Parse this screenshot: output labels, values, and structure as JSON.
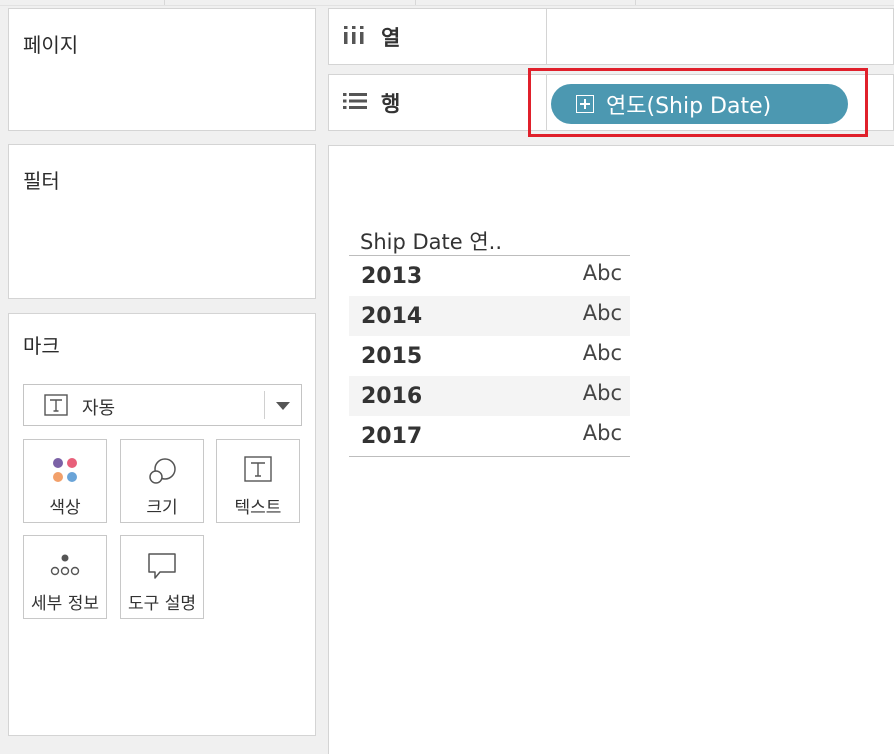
{
  "left_panel": {
    "pages_title": "페이지",
    "filters_title": "필터",
    "marks": {
      "title": "마크",
      "mark_type": "자동",
      "buttons": [
        {
          "label": "색상",
          "icon": "color-dots-icon"
        },
        {
          "label": "크기",
          "icon": "size-circles-icon"
        },
        {
          "label": "텍스트",
          "icon": "text-t-icon"
        },
        {
          "label": "세부 정보",
          "icon": "detail-dots-icon"
        },
        {
          "label": "도구 설명",
          "icon": "tooltip-bubble-icon"
        }
      ]
    }
  },
  "shelves": {
    "columns_label": "열",
    "rows_label": "행",
    "rows_pill": "연도(Ship Date)"
  },
  "view": {
    "header": "Ship Date 연..",
    "rows": [
      {
        "year": "2013",
        "value": "Abc"
      },
      {
        "year": "2014",
        "value": "Abc"
      },
      {
        "year": "2015",
        "value": "Abc"
      },
      {
        "year": "2016",
        "value": "Abc"
      },
      {
        "year": "2017",
        "value": "Abc"
      }
    ]
  },
  "colors": {
    "pill": "#4c98b1",
    "highlight": "#e0202b"
  }
}
